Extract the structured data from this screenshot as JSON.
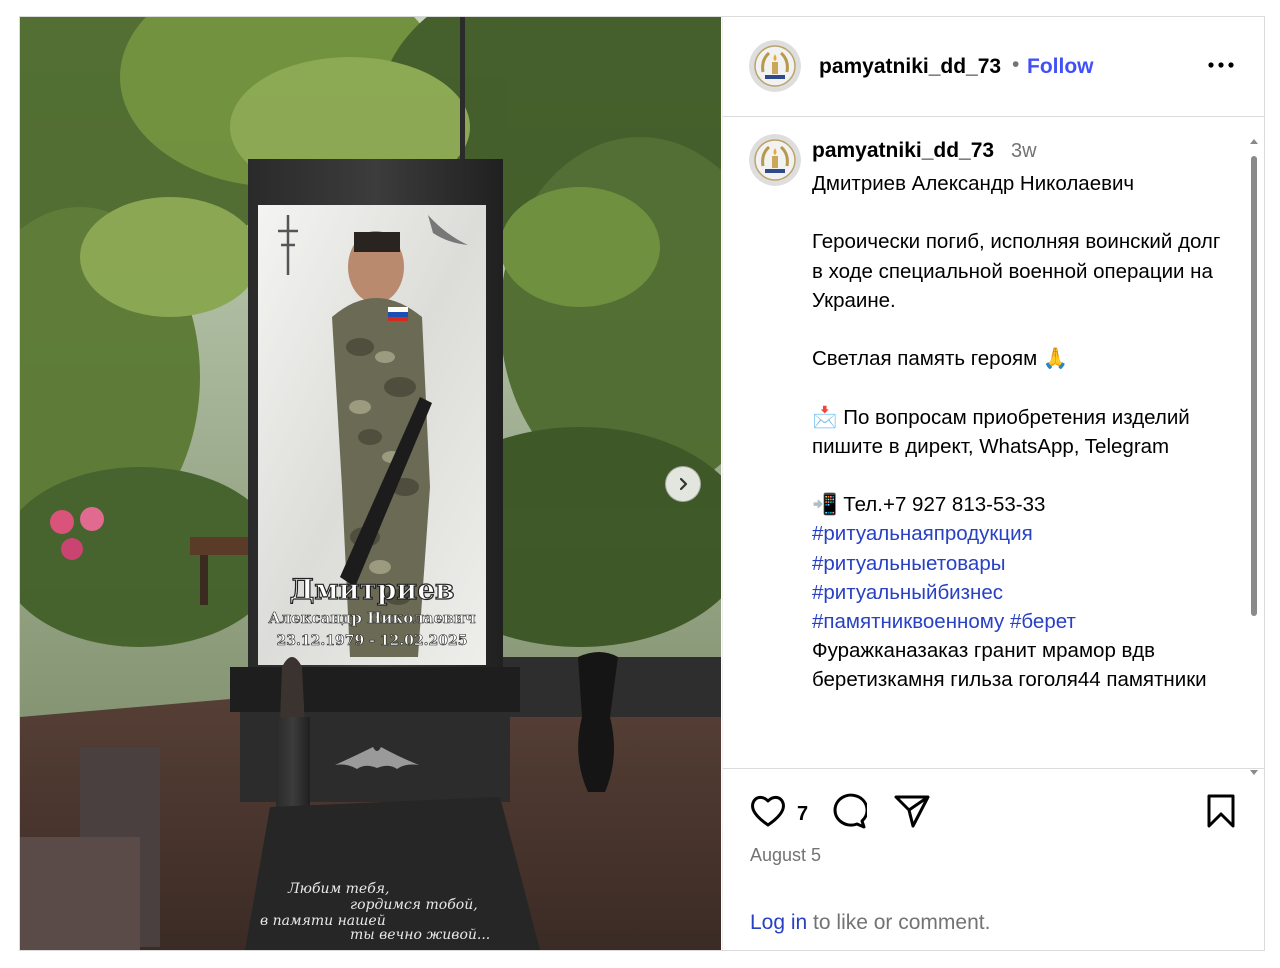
{
  "post": {
    "username": "pamyatniki_dd_73",
    "follow_label": "Follow",
    "dot": "•",
    "time_ago": "3w",
    "caption_lines": [
      {
        "text": "Дмитриев Александр Николаевич",
        "type": "text"
      },
      {
        "text": "",
        "type": "text"
      },
      {
        "text": "Героически погиб, исполняя воинский долг в ходе специальной военной операции на",
        "type": "text"
      },
      {
        "text": "Украине.",
        "type": "text"
      },
      {
        "text": "",
        "type": "text"
      },
      {
        "text": "Светлая память героям 🙏",
        "type": "text"
      },
      {
        "text": "",
        "type": "text"
      },
      {
        "text": "📩 По вопросам приобретения изделий пишите в директ, WhatsApp, Telegram",
        "type": "text"
      },
      {
        "text": "",
        "type": "text"
      },
      {
        "text": "📲 Тел.+7 927 813-53-33",
        "type": "text"
      },
      {
        "text": "#ритуальнаяпродукция",
        "type": "tag"
      },
      {
        "text": "#ритуальныетовары",
        "type": "tag"
      },
      {
        "text": "#ритуальныйбизнес",
        "type": "tag"
      },
      {
        "text": "#памятниквоенному #берет",
        "type": "tag"
      },
      {
        "text": "Фуражканазаказ гранит мрамор вдв беретизкамня гильза гоголя44 памятники",
        "type": "text"
      }
    ],
    "likes": "7",
    "date": "August 5",
    "login_link": "Log in",
    "login_rest": " to like or comment."
  },
  "photo": {
    "surname": "Дмитриев",
    "full_name": "Александр Николаевич",
    "dates": "23.12.1979 - 12.02.2025",
    "epitaph_lines": [
      "Любим тебя,",
      "гордимся тобой,",
      "в памяти нашей",
      "ты вечно живой..."
    ]
  },
  "icons": {
    "avatar": "wreath-logo-icon",
    "more": "more-options-icon",
    "next": "chevron-right-icon",
    "like": "heart-icon",
    "comment": "comment-icon",
    "share": "share-icon",
    "save": "bookmark-icon"
  },
  "colors": {
    "follow": "#4150f7",
    "link": "#2840c4",
    "muted": "#737373"
  }
}
